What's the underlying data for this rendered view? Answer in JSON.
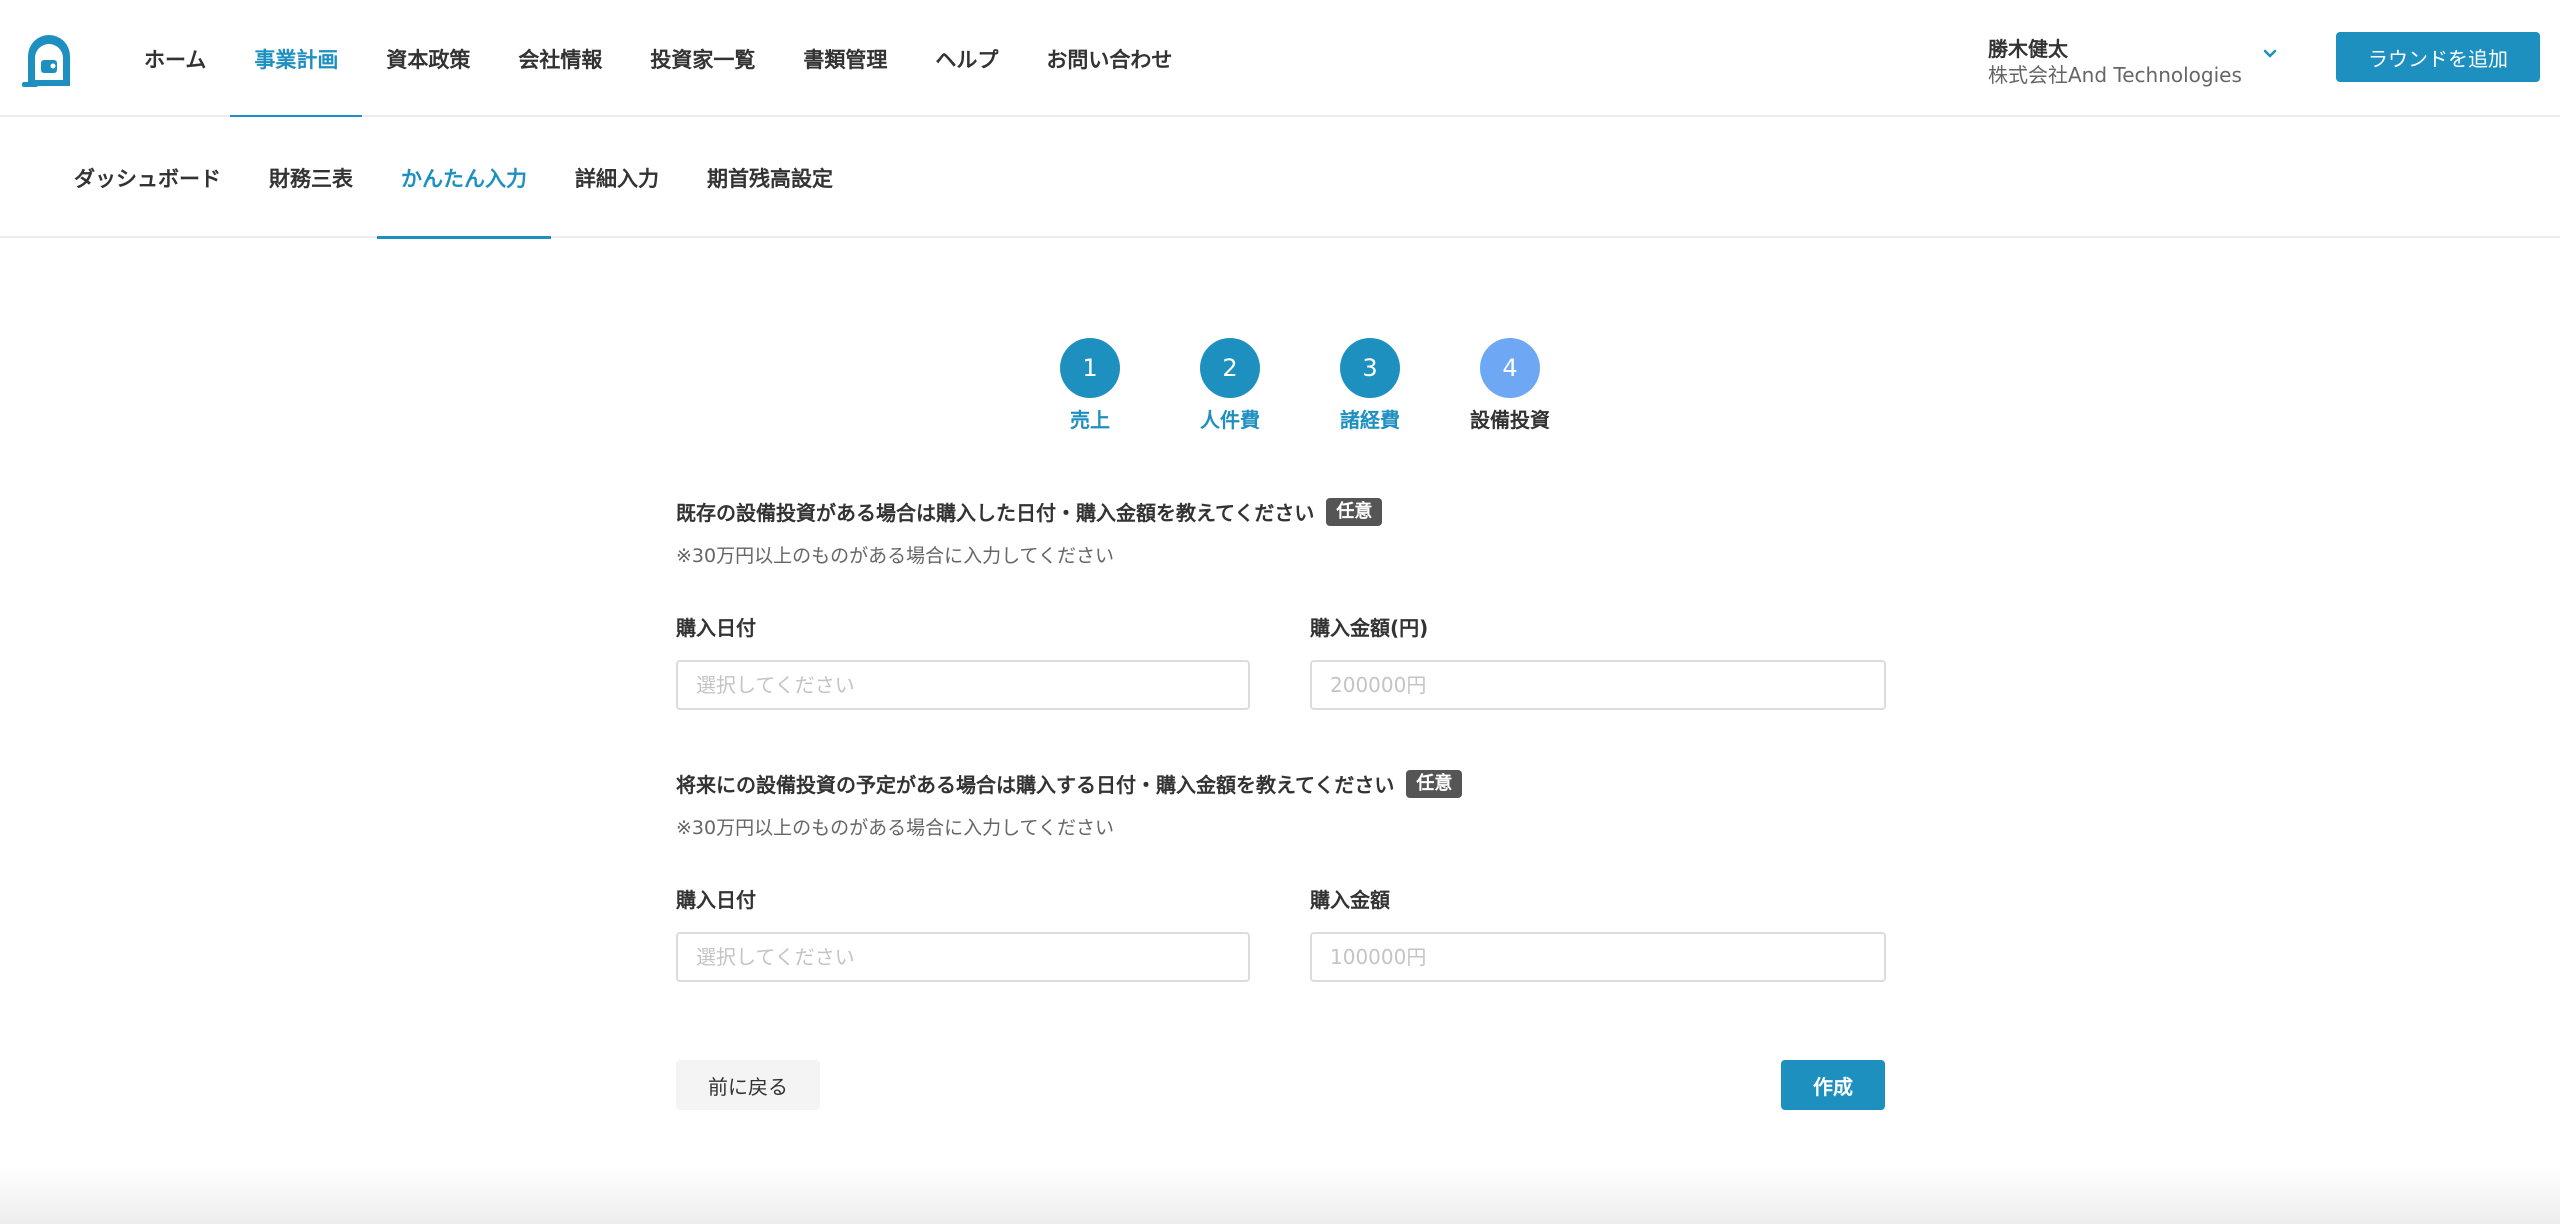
{
  "header": {
    "logo_icon": "door-logo-icon",
    "nav": [
      {
        "label": "ホーム",
        "active": false
      },
      {
        "label": "事業計画",
        "active": true
      },
      {
        "label": "資本政策",
        "active": false
      },
      {
        "label": "会社情報",
        "active": false
      },
      {
        "label": "投資家一覧",
        "active": false
      },
      {
        "label": "書類管理",
        "active": false
      },
      {
        "label": "ヘルプ",
        "active": false
      },
      {
        "label": "お問い合わせ",
        "active": false
      }
    ],
    "user": {
      "name": "勝木健太",
      "company": "株式会社And Technologies",
      "chevron_icon": "chevron-down-icon"
    },
    "add_round_label": "ラウンドを追加"
  },
  "subnav": [
    {
      "label": "ダッシュボード",
      "active": false
    },
    {
      "label": "財務三表",
      "active": false
    },
    {
      "label": "かんたん入力",
      "active": true
    },
    {
      "label": "詳細入力",
      "active": false
    },
    {
      "label": "期首残高設定",
      "active": false
    }
  ],
  "steps": [
    {
      "number": "1",
      "label": "売上",
      "state": "done"
    },
    {
      "number": "2",
      "label": "人件費",
      "state": "done"
    },
    {
      "number": "3",
      "label": "諸経費",
      "state": "done"
    },
    {
      "number": "4",
      "label": "設備投資",
      "state": "current"
    }
  ],
  "existing": {
    "title": "既存の設備投資がある場合は購入した日付・購入金額を教えてください",
    "badge": "任意",
    "note": "※30万円以上のものがある場合に入力してください",
    "date_label": "購入日付",
    "date_placeholder": "選択してください",
    "amount_label": "購入金額(円)",
    "amount_placeholder": "200000円"
  },
  "future": {
    "title": "将来にの設備投資の予定がある場合は購入する日付・購入金額を教えてください",
    "badge": "任意",
    "note": "※30万円以上のものがある場合に入力してください",
    "date_label": "購入日付",
    "date_placeholder": "選択してください",
    "amount_label": "購入金額",
    "amount_placeholder": "100000円"
  },
  "actions": {
    "back_label": "前に戻る",
    "create_label": "作成"
  },
  "colors": {
    "accent": "#1e90c0",
    "step_current": "#6ea8f5",
    "badge": "#555555"
  }
}
